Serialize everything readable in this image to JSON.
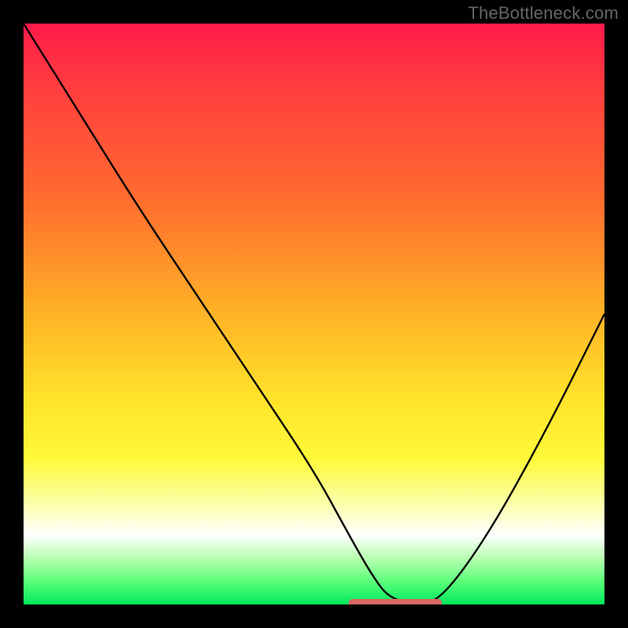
{
  "watermark": "TheBottleneck.com",
  "chart_data": {
    "type": "line",
    "title": "",
    "xlabel": "",
    "ylabel": "",
    "xlim": [
      0,
      100
    ],
    "ylim": [
      0,
      100
    ],
    "gradient_stops": [
      {
        "pos": 0,
        "color": "#ff1a4a"
      },
      {
        "pos": 10,
        "color": "#ff3b3f"
      },
      {
        "pos": 30,
        "color": "#ff6b2f"
      },
      {
        "pos": 50,
        "color": "#ffb326"
      },
      {
        "pos": 65,
        "color": "#ffe42a"
      },
      {
        "pos": 75,
        "color": "#fff93a"
      },
      {
        "pos": 82,
        "color": "#fbffa0"
      },
      {
        "pos": 88,
        "color": "#ffffff"
      },
      {
        "pos": 92,
        "color": "#b8ffb0"
      },
      {
        "pos": 96,
        "color": "#5dff7a"
      },
      {
        "pos": 100,
        "color": "#00e85e"
      }
    ],
    "series": [
      {
        "name": "bottleneck-curve",
        "x": [
          0,
          10,
          20,
          30,
          40,
          50,
          56,
          60,
          63,
          68,
          72,
          80,
          90,
          100
        ],
        "y": [
          100,
          84,
          68,
          53,
          38,
          23,
          12,
          5,
          1,
          0,
          1,
          12,
          30,
          50
        ]
      }
    ],
    "optimal_range": {
      "x_start": 56,
      "x_end": 72,
      "color": "#d46a63"
    }
  }
}
